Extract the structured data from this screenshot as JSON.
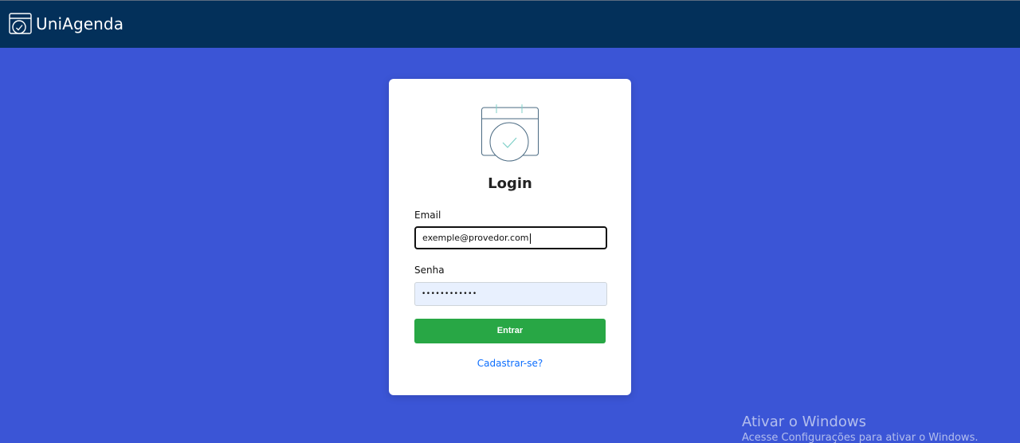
{
  "header": {
    "app_name": "UniAgenda",
    "logo_icon": "calendar-check-icon",
    "background_color": "#03305a"
  },
  "page": {
    "background_color": "#3b55d6"
  },
  "login_card": {
    "icon": "calendar-check-icon",
    "title": "Login",
    "email": {
      "label": "Email",
      "value": "exemple@provedor.com"
    },
    "password": {
      "label": "Senha",
      "value": "••••••••••••"
    },
    "submit_label": "Entrar",
    "submit_color": "#28a745",
    "register_link": "Cadastrar-se?",
    "link_color": "#0d6efd"
  },
  "watermark": {
    "title": "Ativar o Windows",
    "subtitle": "Acesse Configurações para ativar o Windows."
  }
}
